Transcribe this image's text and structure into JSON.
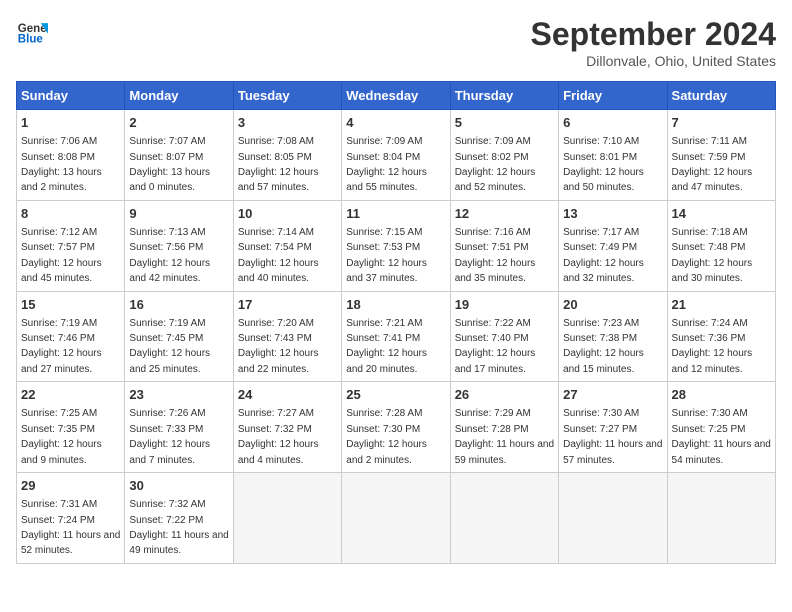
{
  "header": {
    "logo_line1": "General",
    "logo_line2": "Blue",
    "month_title": "September 2024",
    "location": "Dillonvale, Ohio, United States"
  },
  "days_of_week": [
    "Sunday",
    "Monday",
    "Tuesday",
    "Wednesday",
    "Thursday",
    "Friday",
    "Saturday"
  ],
  "weeks": [
    [
      {
        "day": "1",
        "sunrise": "7:06 AM",
        "sunset": "8:08 PM",
        "daylight": "13 hours and 2 minutes."
      },
      {
        "day": "2",
        "sunrise": "7:07 AM",
        "sunset": "8:07 PM",
        "daylight": "13 hours and 0 minutes."
      },
      {
        "day": "3",
        "sunrise": "7:08 AM",
        "sunset": "8:05 PM",
        "daylight": "12 hours and 57 minutes."
      },
      {
        "day": "4",
        "sunrise": "7:09 AM",
        "sunset": "8:04 PM",
        "daylight": "12 hours and 55 minutes."
      },
      {
        "day": "5",
        "sunrise": "7:09 AM",
        "sunset": "8:02 PM",
        "daylight": "12 hours and 52 minutes."
      },
      {
        "day": "6",
        "sunrise": "7:10 AM",
        "sunset": "8:01 PM",
        "daylight": "12 hours and 50 minutes."
      },
      {
        "day": "7",
        "sunrise": "7:11 AM",
        "sunset": "7:59 PM",
        "daylight": "12 hours and 47 minutes."
      }
    ],
    [
      {
        "day": "8",
        "sunrise": "7:12 AM",
        "sunset": "7:57 PM",
        "daylight": "12 hours and 45 minutes."
      },
      {
        "day": "9",
        "sunrise": "7:13 AM",
        "sunset": "7:56 PM",
        "daylight": "12 hours and 42 minutes."
      },
      {
        "day": "10",
        "sunrise": "7:14 AM",
        "sunset": "7:54 PM",
        "daylight": "12 hours and 40 minutes."
      },
      {
        "day": "11",
        "sunrise": "7:15 AM",
        "sunset": "7:53 PM",
        "daylight": "12 hours and 37 minutes."
      },
      {
        "day": "12",
        "sunrise": "7:16 AM",
        "sunset": "7:51 PM",
        "daylight": "12 hours and 35 minutes."
      },
      {
        "day": "13",
        "sunrise": "7:17 AM",
        "sunset": "7:49 PM",
        "daylight": "12 hours and 32 minutes."
      },
      {
        "day": "14",
        "sunrise": "7:18 AM",
        "sunset": "7:48 PM",
        "daylight": "12 hours and 30 minutes."
      }
    ],
    [
      {
        "day": "15",
        "sunrise": "7:19 AM",
        "sunset": "7:46 PM",
        "daylight": "12 hours and 27 minutes."
      },
      {
        "day": "16",
        "sunrise": "7:19 AM",
        "sunset": "7:45 PM",
        "daylight": "12 hours and 25 minutes."
      },
      {
        "day": "17",
        "sunrise": "7:20 AM",
        "sunset": "7:43 PM",
        "daylight": "12 hours and 22 minutes."
      },
      {
        "day": "18",
        "sunrise": "7:21 AM",
        "sunset": "7:41 PM",
        "daylight": "12 hours and 20 minutes."
      },
      {
        "day": "19",
        "sunrise": "7:22 AM",
        "sunset": "7:40 PM",
        "daylight": "12 hours and 17 minutes."
      },
      {
        "day": "20",
        "sunrise": "7:23 AM",
        "sunset": "7:38 PM",
        "daylight": "12 hours and 15 minutes."
      },
      {
        "day": "21",
        "sunrise": "7:24 AM",
        "sunset": "7:36 PM",
        "daylight": "12 hours and 12 minutes."
      }
    ],
    [
      {
        "day": "22",
        "sunrise": "7:25 AM",
        "sunset": "7:35 PM",
        "daylight": "12 hours and 9 minutes."
      },
      {
        "day": "23",
        "sunrise": "7:26 AM",
        "sunset": "7:33 PM",
        "daylight": "12 hours and 7 minutes."
      },
      {
        "day": "24",
        "sunrise": "7:27 AM",
        "sunset": "7:32 PM",
        "daylight": "12 hours and 4 minutes."
      },
      {
        "day": "25",
        "sunrise": "7:28 AM",
        "sunset": "7:30 PM",
        "daylight": "12 hours and 2 minutes."
      },
      {
        "day": "26",
        "sunrise": "7:29 AM",
        "sunset": "7:28 PM",
        "daylight": "11 hours and 59 minutes."
      },
      {
        "day": "27",
        "sunrise": "7:30 AM",
        "sunset": "7:27 PM",
        "daylight": "11 hours and 57 minutes."
      },
      {
        "day": "28",
        "sunrise": "7:30 AM",
        "sunset": "7:25 PM",
        "daylight": "11 hours and 54 minutes."
      }
    ],
    [
      {
        "day": "29",
        "sunrise": "7:31 AM",
        "sunset": "7:24 PM",
        "daylight": "11 hours and 52 minutes."
      },
      {
        "day": "30",
        "sunrise": "7:32 AM",
        "sunset": "7:22 PM",
        "daylight": "11 hours and 49 minutes."
      },
      null,
      null,
      null,
      null,
      null
    ]
  ]
}
